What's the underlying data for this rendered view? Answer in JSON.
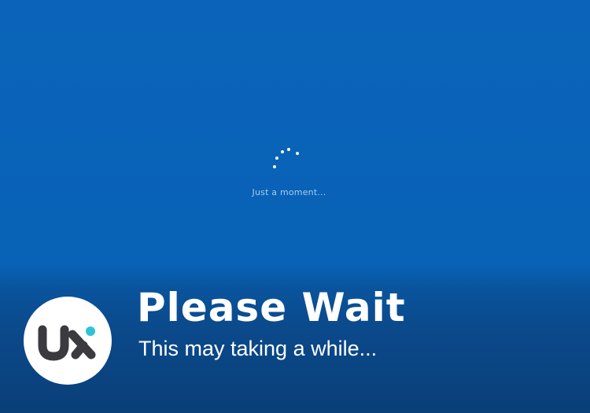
{
  "screen": {
    "loading_text": "Just a moment...",
    "background_color": "#0b63b8",
    "spinner_icon": "loading-dots-spinner"
  },
  "banner": {
    "title": "Please Wait",
    "subtitle": "This may taking a while...",
    "logo": {
      "text": "ux",
      "icon": "ux-logo-icon",
      "text_color": "#3a3a3f",
      "accent_color": "#2ec4d6",
      "background": "#ffffff"
    }
  }
}
